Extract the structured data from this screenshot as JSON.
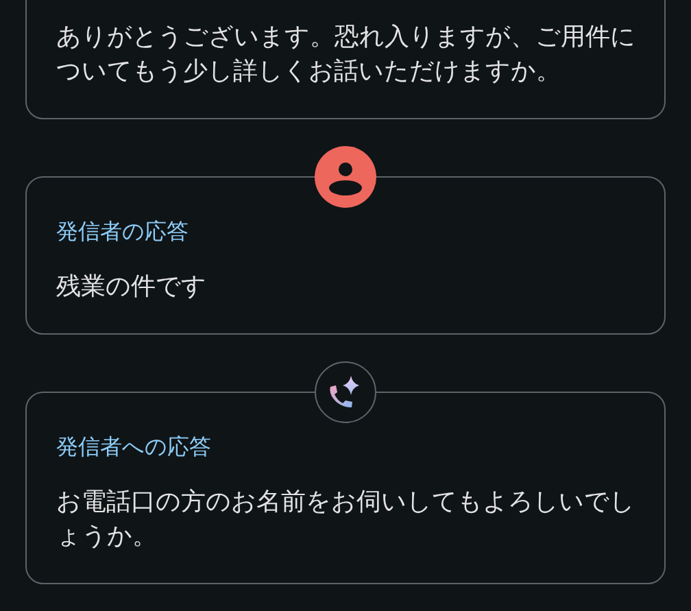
{
  "messages": [
    {
      "cut_off_top": true,
      "text": "ありがとうございます。恐れ入りますが、ご用件についてもう少し詳しくお話いただけますか。"
    },
    {
      "kind": "caller",
      "cut_off_top": false,
      "label": "発信者の応答",
      "text": "残業の件です"
    },
    {
      "kind": "assistant",
      "cut_off_top": false,
      "label": "発信者への応答",
      "text": "お電話口の方のお名前をお伺いしてもよろしいでしょうか。"
    }
  ]
}
